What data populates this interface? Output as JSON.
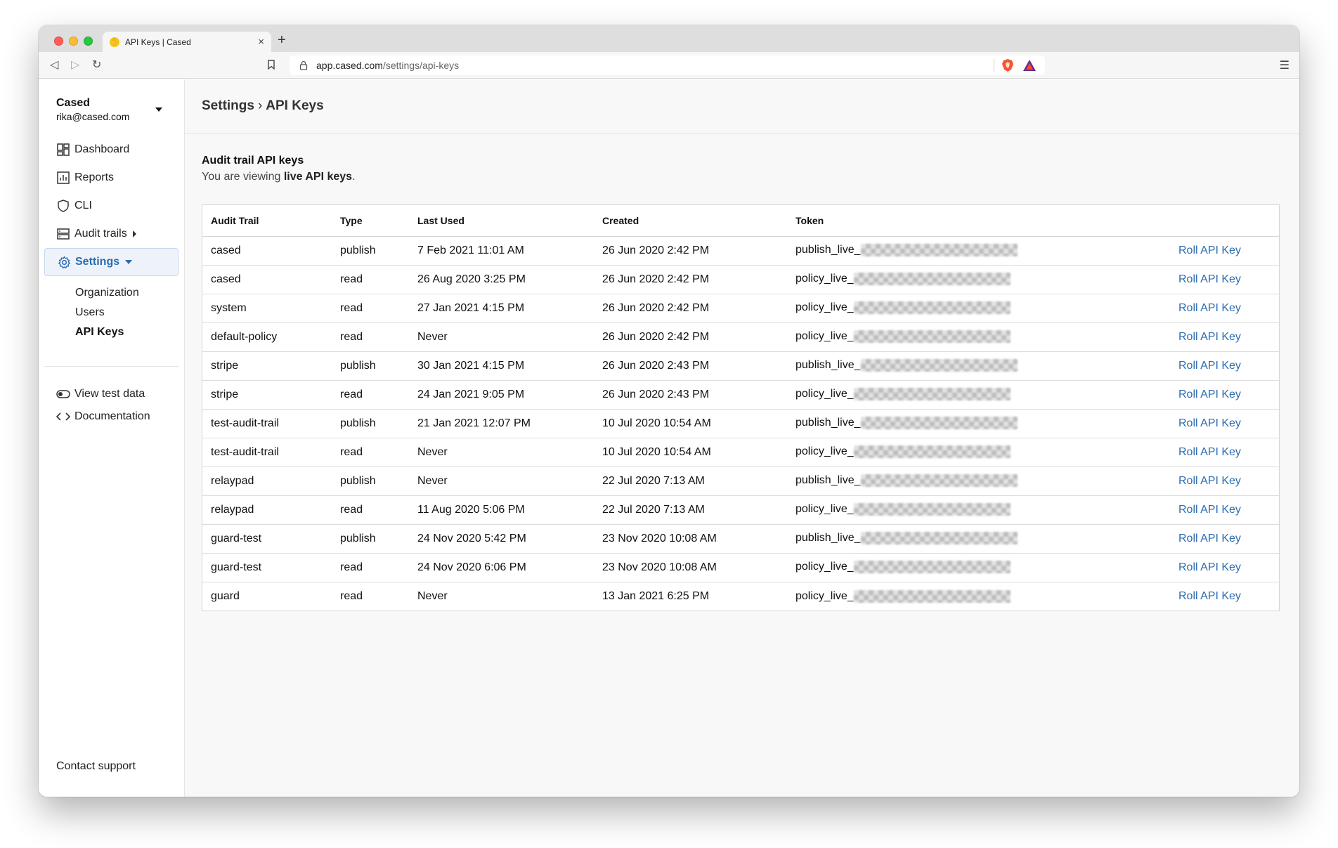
{
  "browser": {
    "tab_title": "API Keys | Cased",
    "url_host": "app.cased.com",
    "url_path": "/settings/api-keys"
  },
  "sidebar": {
    "org_name": "Cased",
    "org_email": "rika@cased.com",
    "items": [
      {
        "label": "Dashboard",
        "icon": "dashboard-icon"
      },
      {
        "label": "Reports",
        "icon": "reports-icon"
      },
      {
        "label": "CLI",
        "icon": "shield-icon"
      },
      {
        "label": "Audit trails",
        "icon": "audit-trails-icon"
      },
      {
        "label": "Settings",
        "icon": "gear-icon"
      }
    ],
    "subitems": [
      "Organization",
      "Users",
      "API Keys"
    ],
    "links": [
      {
        "label": "View test data",
        "icon": "toggle-icon"
      },
      {
        "label": "Documentation",
        "icon": "code-icon"
      }
    ],
    "contact": "Contact support"
  },
  "header": {
    "crumb_parent": "Settings",
    "crumb_separator": "›",
    "crumb_current": "API Keys"
  },
  "section": {
    "title": "Audit trail API keys",
    "sub_prefix": "You are viewing ",
    "sub_bold": "live API keys",
    "sub_suffix": "."
  },
  "table": {
    "columns": [
      "Audit Trail",
      "Type",
      "Last Used",
      "Created",
      "Token",
      ""
    ],
    "action_label": "Roll API Key",
    "rows": [
      {
        "trail": "cased",
        "type": "publish",
        "last_used": "7 Feb 2021 11:01 AM",
        "created": "26 Jun 2020 2:42 PM",
        "token_prefix": "publish_live_"
      },
      {
        "trail": "cased",
        "type": "read",
        "last_used": "26 Aug 2020 3:25 PM",
        "created": "26 Jun 2020 2:42 PM",
        "token_prefix": "policy_live_"
      },
      {
        "trail": "system",
        "type": "read",
        "last_used": "27 Jan 2021 4:15 PM",
        "created": "26 Jun 2020 2:42 PM",
        "token_prefix": "policy_live_"
      },
      {
        "trail": "default-policy",
        "type": "read",
        "last_used": "Never",
        "created": "26 Jun 2020 2:42 PM",
        "token_prefix": "policy_live_"
      },
      {
        "trail": "stripe",
        "type": "publish",
        "last_used": "30 Jan 2021 4:15 PM",
        "created": "26 Jun 2020 2:43 PM",
        "token_prefix": "publish_live_"
      },
      {
        "trail": "stripe",
        "type": "read",
        "last_used": "24 Jan 2021 9:05 PM",
        "created": "26 Jun 2020 2:43 PM",
        "token_prefix": "policy_live_"
      },
      {
        "trail": "test-audit-trail",
        "type": "publish",
        "last_used": "21 Jan 2021 12:07 PM",
        "created": "10 Jul 2020 10:54 AM",
        "token_prefix": "publish_live_"
      },
      {
        "trail": "test-audit-trail",
        "type": "read",
        "last_used": "Never",
        "created": "10 Jul 2020 10:54 AM",
        "token_prefix": "policy_live_"
      },
      {
        "trail": "relaypad",
        "type": "publish",
        "last_used": "Never",
        "created": "22 Jul 2020 7:13 AM",
        "token_prefix": "publish_live_"
      },
      {
        "trail": "relaypad",
        "type": "read",
        "last_used": "11 Aug 2020 5:06 PM",
        "created": "22 Jul 2020 7:13 AM",
        "token_prefix": "policy_live_"
      },
      {
        "trail": "guard-test",
        "type": "publish",
        "last_used": "24 Nov 2020 5:42 PM",
        "created": "23 Nov 2020 10:08 AM",
        "token_prefix": "publish_live_"
      },
      {
        "trail": "guard-test",
        "type": "read",
        "last_used": "24 Nov 2020 6:06 PM",
        "created": "23 Nov 2020 10:08 AM",
        "token_prefix": "policy_live_"
      },
      {
        "trail": "guard",
        "type": "read",
        "last_used": "Never",
        "created": "13 Jan 2021 6:25 PM",
        "token_prefix": "policy_live_"
      }
    ]
  },
  "colors": {
    "accent": "#2b6cb0",
    "active_bg": "#eef3fb",
    "main_bg": "#f8f8f9"
  }
}
